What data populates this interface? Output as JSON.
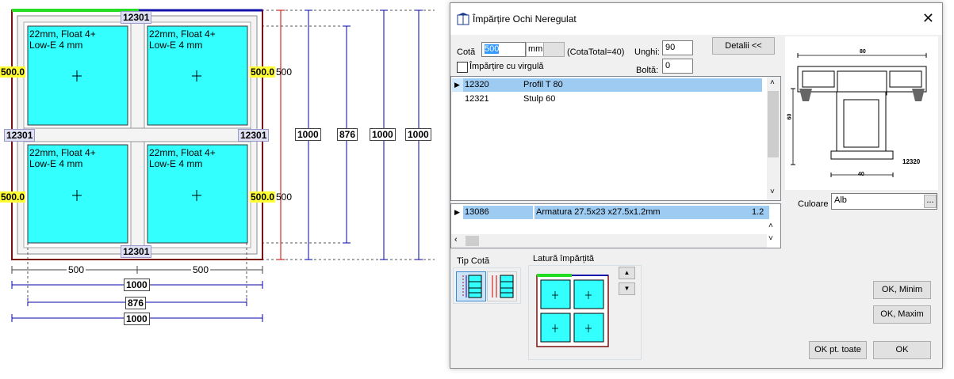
{
  "drawing": {
    "top_profile": "12301",
    "bottom_profile": "12301",
    "mid_left_profile": "12301",
    "mid_right_profile": "12301",
    "left_tag_top": "500.0",
    "left_tag_bottom": "500.0",
    "right_tag_top": "500.0",
    "right_tag_top_suffix": "500",
    "right_tag_bottom": "500.0",
    "right_tag_bottom_suffix": "500",
    "glass_line1": "22mm, Float 4+",
    "glass_line2": "Low-E 4 mm",
    "dim_vertical": [
      "1000",
      "876",
      "1000",
      "1000"
    ],
    "dim_half_left": "500",
    "dim_half_right": "500",
    "dim_h1": "1000",
    "dim_h2": "876",
    "dim_h3": "1000"
  },
  "dialog": {
    "title": "Împărțire Ochi Neregulat",
    "cota_label": "Cotă",
    "cota_value": "500",
    "unit": "mm",
    "cota_total": "(CotaTotal=40)",
    "unghi_label": "Unghi:",
    "unghi_value": "90",
    "bolta_label": "Boltă:",
    "bolta_value": "0",
    "virgula_label": "Împărțire cu virgulă",
    "detalii_button": "Detalii <<",
    "profiles": [
      {
        "code": "12320",
        "name": "Profil T 80"
      },
      {
        "code": "12321",
        "name": "Stulp 60"
      }
    ],
    "armatura": {
      "code": "13086",
      "name": "Armatura 27.5x23 x27.5x1.2mm",
      "value": "1.2"
    },
    "culoare_label": "Culoare",
    "culoare_value": "Alb",
    "culoare_btn": "...",
    "tip_cota_label": "Tip Cotă",
    "latura_label": "Latură împărțită",
    "ok_minim": "OK, Minim",
    "ok_maxim": "OK, Maxim",
    "ok_toate": "OK pt. toate",
    "ok": "OK",
    "profile_drawing": {
      "top": "80",
      "side": "60",
      "bottom": "40",
      "code": "12320"
    }
  }
}
